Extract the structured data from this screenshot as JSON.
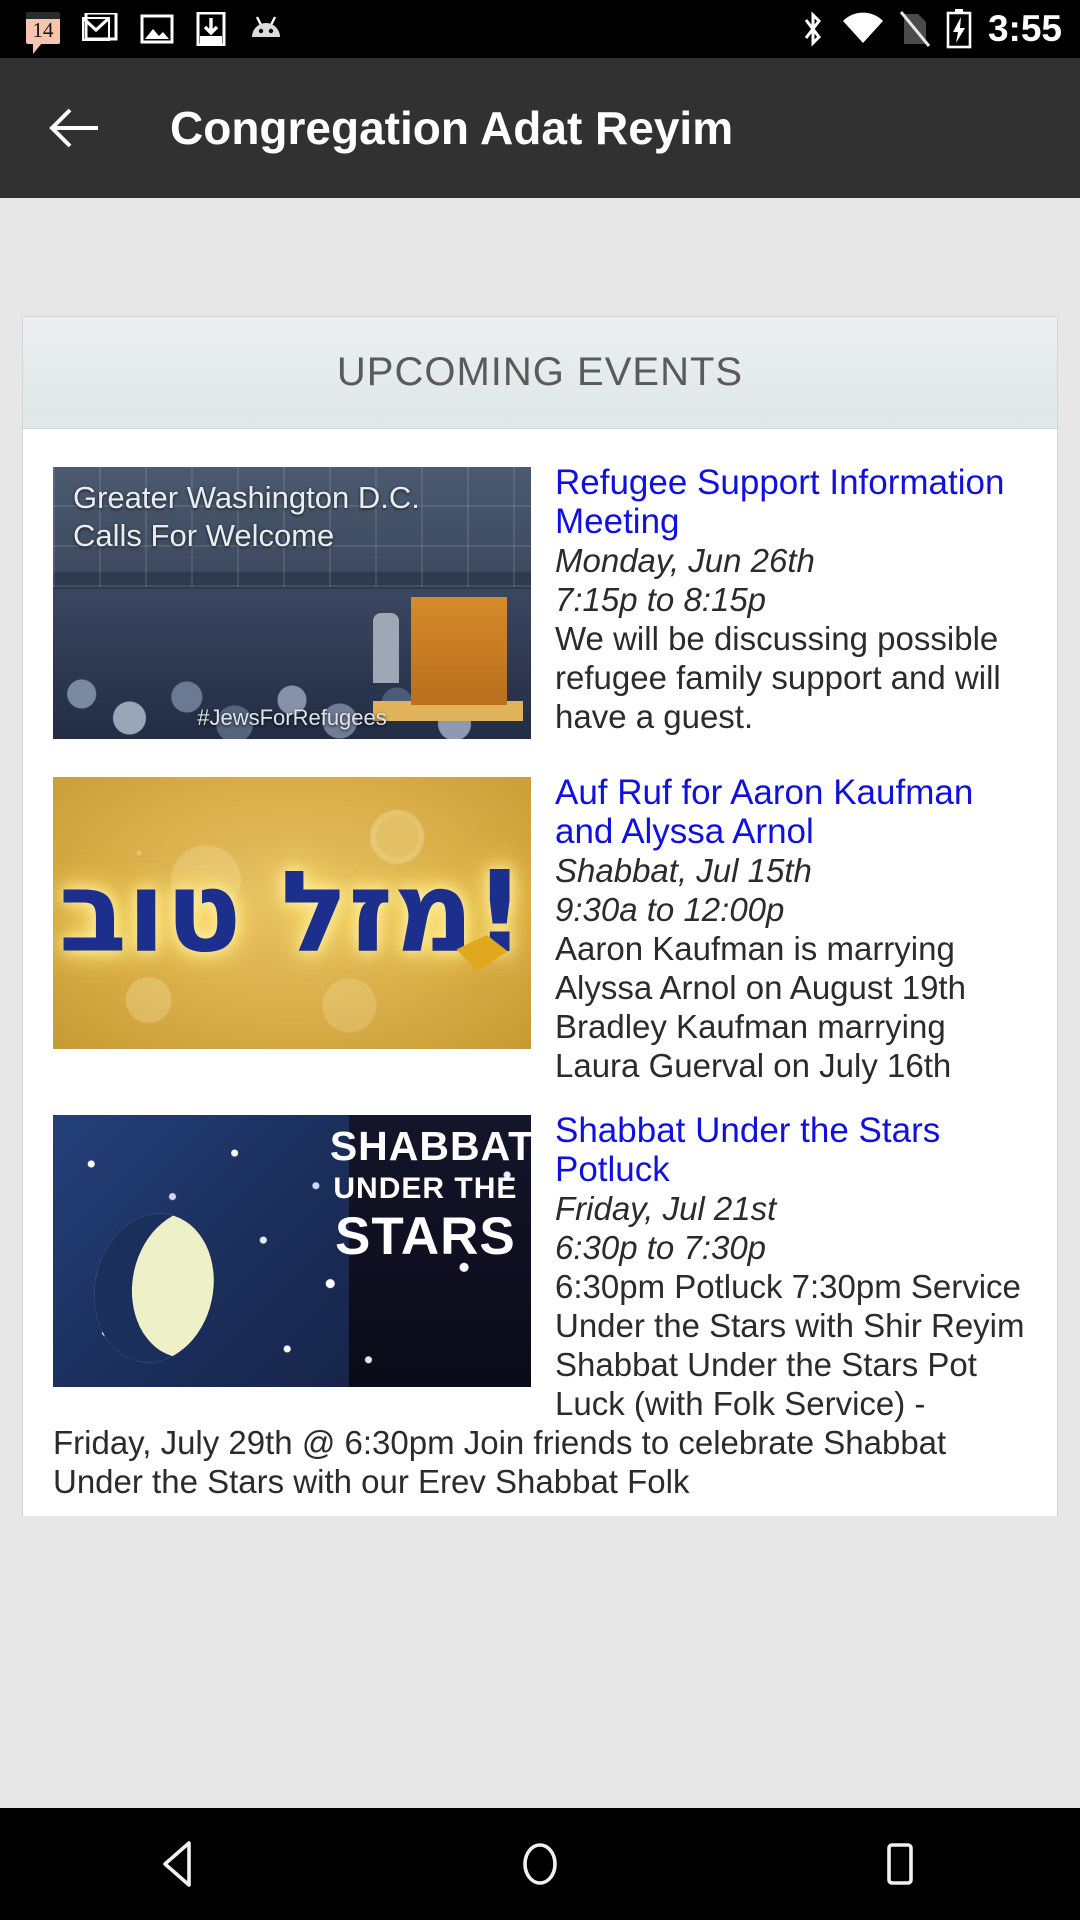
{
  "status_bar": {
    "icons": [
      {
        "name": "calendar-icon",
        "badge": "14"
      },
      {
        "name": "gmail-icon"
      },
      {
        "name": "photos-icon"
      },
      {
        "name": "download-icon"
      },
      {
        "name": "android-icon"
      }
    ],
    "right_icons": [
      {
        "name": "bluetooth-icon"
      },
      {
        "name": "wifi-icon"
      },
      {
        "name": "no-sim-icon"
      },
      {
        "name": "battery-charging-icon"
      }
    ],
    "time": "3:55"
  },
  "app_bar": {
    "back_icon": "back-arrow-icon",
    "title": "Congregation Adat Reyim"
  },
  "card": {
    "header_title": "UPCOMING EVENTS",
    "events": [
      {
        "title": "Refugee Support Information Meeting",
        "date": "Monday, Jun 26th",
        "time": "7:15p to 8:15p",
        "description": "We will be discussing possible refugee family support and will have a guest.",
        "thumb": {
          "name": "refugee-rally-thumbnail",
          "line1": "Greater Washington D.C.",
          "line2": "Calls For Welcome",
          "hashtag": "#JewsForRefugees"
        }
      },
      {
        "title": "Auf Ruf for Aaron Kaufman and Alyssa Arnol",
        "date": "Shabbat, Jul 15th",
        "time": "9:30a to 12:00p",
        "description": "Aaron Kaufman is marrying Alyssa Arnol on August 19th Bradley Kaufman marrying Laura Guerval on July 16th",
        "thumb": {
          "name": "mazel-tov-thumbnail",
          "hebrew": "!מזל טוב"
        }
      },
      {
        "title": "Shabbat Under the Stars Potluck",
        "date": "Friday, Jul 21st",
        "time": "6:30p to 7:30p",
        "description": "6:30pm Potluck 7:30pm Service Under the Stars with Shir Reyim Shabbat Under the Stars Pot Luck (with Folk Service) - Friday, July 29th @ 6:30pm Join friends to celebrate Shabbat Under the Stars with our Erev Shabbat Folk",
        "thumb": {
          "name": "shabbat-under-the-stars-thumbnail",
          "line1": "SHABBAT",
          "line2": "UNDER THE",
          "line3": "STARS"
        }
      }
    ]
  },
  "nav_bar": {
    "back": "nav-back-icon",
    "home": "nav-home-icon",
    "recents": "nav-recents-icon"
  },
  "colors": {
    "app_bar": "#313131",
    "link": "#1111dd",
    "card_header": "#dfe7e9",
    "page_bg": "#e7e7e7"
  }
}
